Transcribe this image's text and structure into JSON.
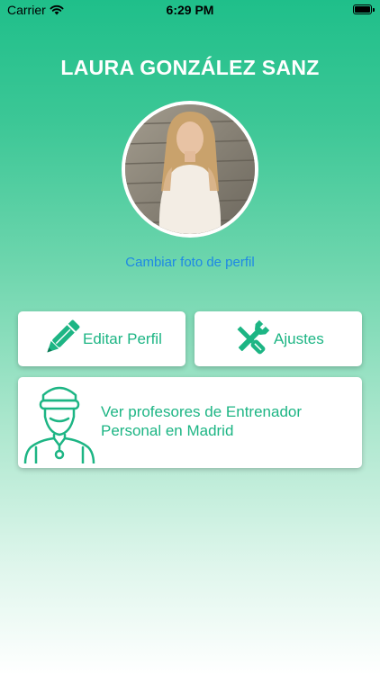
{
  "status_bar": {
    "carrier": "Carrier",
    "time": "6:29 PM"
  },
  "profile": {
    "name": "LAURA GONZÁLEZ SANZ",
    "change_photo_label": "Cambiar foto de perfil"
  },
  "actions": {
    "edit_profile_label": "Editar Perfil",
    "settings_label": "Ajustes",
    "trainers_label": "Ver profesores de Entrenador Personal en Madrid"
  },
  "colors": {
    "accent_green": "#1db584",
    "link_blue": "#1e88e5"
  },
  "icons": {
    "edit": "pencil-icon",
    "settings": "wrench-screwdriver-icon",
    "trainers": "coach-whistle-icon"
  }
}
